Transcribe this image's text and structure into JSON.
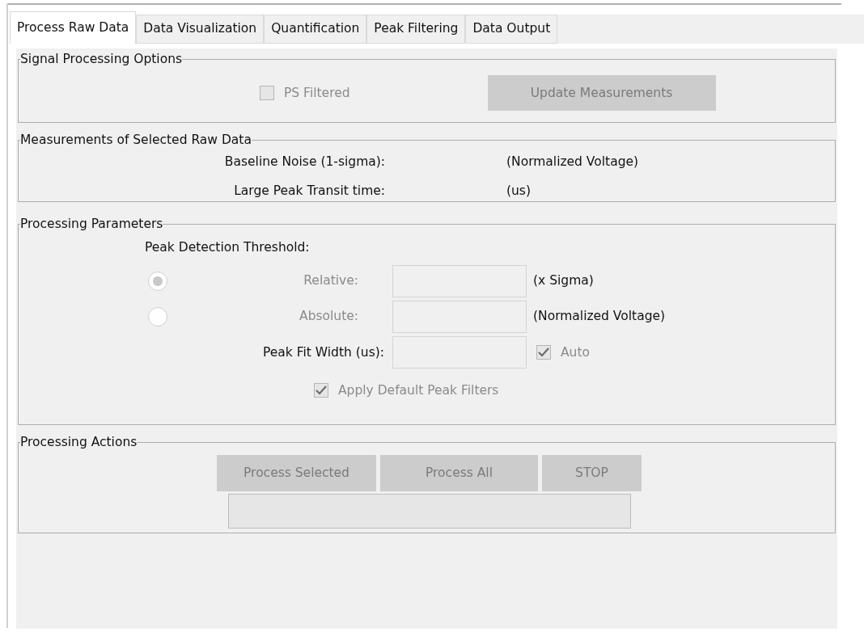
{
  "tabs": [
    {
      "label": "Process Raw Data",
      "selected": true
    },
    {
      "label": "Data Visualization",
      "selected": false
    },
    {
      "label": "Quantification",
      "selected": false
    },
    {
      "label": "Peak Filtering",
      "selected": false
    },
    {
      "label": "Data Output",
      "selected": false
    }
  ],
  "signal_processing": {
    "title": "Signal Processing Options",
    "ps_filtered": {
      "label": "PS Filtered",
      "checked": false,
      "disabled": true
    },
    "update_button": {
      "label": "Update Measurements",
      "disabled": true
    }
  },
  "measurements": {
    "title": "Measurements of Selected Raw Data",
    "rows": [
      {
        "label": "Baseline Noise (1-sigma):",
        "unit": "(Normalized Voltage)"
      },
      {
        "label": "Large Peak Transit time:",
        "unit": "(us)"
      }
    ]
  },
  "parameters": {
    "title": "Processing Parameters",
    "threshold_label": "Peak Detection Threshold:",
    "options": [
      {
        "label": "Relative:",
        "unit": "(x Sigma)",
        "selected": true,
        "disabled": true
      },
      {
        "label": "Absolute:",
        "unit": "(Normalized Voltage)",
        "selected": false,
        "disabled": true
      }
    ],
    "fit_width": {
      "label": "Peak Fit Width (us):",
      "auto": {
        "label": "Auto",
        "checked": true,
        "disabled": true
      }
    },
    "apply_default": {
      "label": "Apply Default Peak Filters",
      "checked": true,
      "disabled": true
    }
  },
  "actions": {
    "title": "Processing Actions",
    "buttons": [
      {
        "label": "Process Selected",
        "disabled": true
      },
      {
        "label": "Process All",
        "disabled": true
      },
      {
        "label": "STOP",
        "disabled": true
      }
    ],
    "progress": {
      "level": 0
    }
  }
}
